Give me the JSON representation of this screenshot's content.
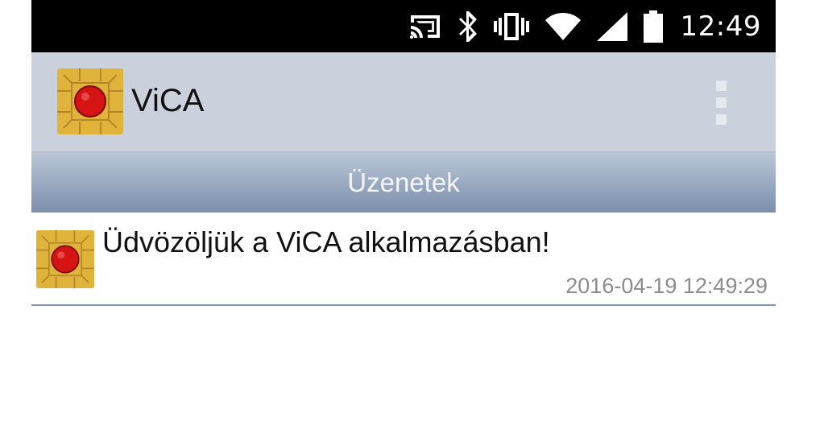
{
  "status_bar": {
    "time": "12:49",
    "icons": [
      "cast-icon",
      "bluetooth-icon",
      "vibrate-icon",
      "wifi-icon",
      "signal-icon",
      "battery-icon"
    ]
  },
  "app_bar": {
    "title": "ViCA",
    "logo_icon": "vica-chip-logo",
    "menu_icon": "overflow-menu-icon"
  },
  "tab": {
    "label": "Üzenetek"
  },
  "messages": [
    {
      "title": "Üdvözöljük a ViCA alkalmazásban!",
      "timestamp": "2016-04-19 12:49:29",
      "icon": "vica-chip-logo"
    }
  ],
  "colors": {
    "status_bar": "#000000",
    "app_bar": "#cbd1dc",
    "tab_gradient_top": "#bac6d6",
    "tab_gradient_bottom": "#7c8fad",
    "divider": "#7f90ab",
    "timestamp": "#8c8c8c",
    "logo_gold": "#e0b43a",
    "logo_red": "#d61414"
  }
}
